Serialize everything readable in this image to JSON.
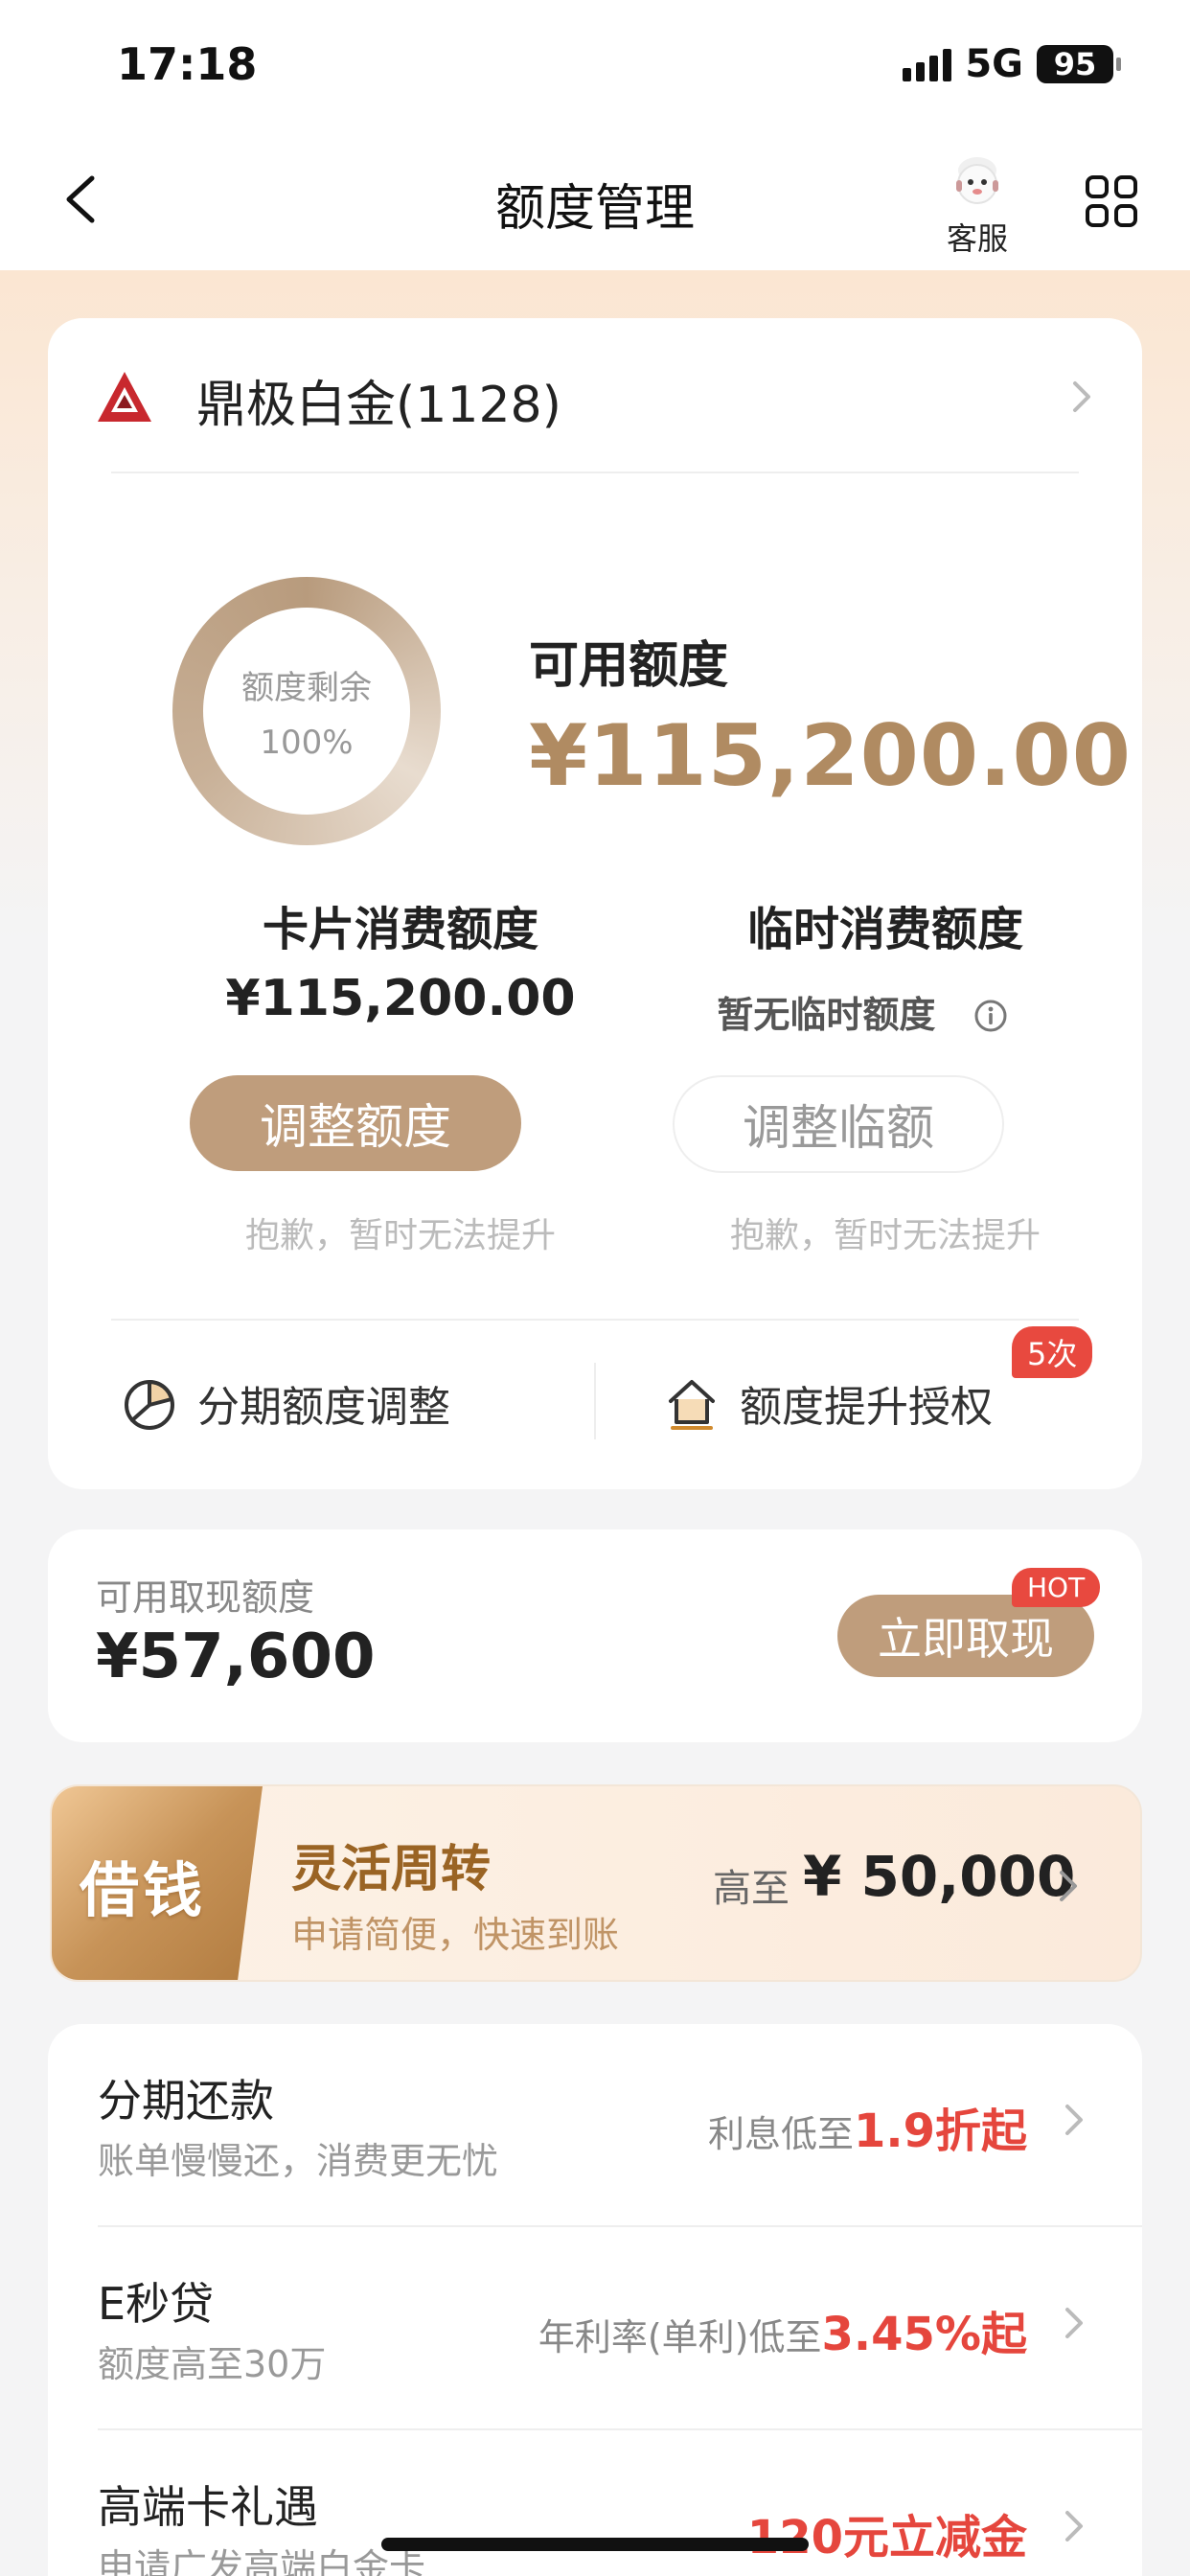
{
  "status_bar": {
    "time": "17:18",
    "network": "5G",
    "battery": "95"
  },
  "nav": {
    "title": "额度管理",
    "service_label": "客服"
  },
  "card": {
    "name": "鼎极白金(1128)",
    "ring_label": "额度剩余",
    "ring_percent": "100%",
    "ring_fill_percent": 100,
    "available_label": "可用额度",
    "available_value": "¥115,200.00"
  },
  "consumption": {
    "title": "卡片消费额度",
    "value": "¥115,200.00",
    "button": "调整额度",
    "note": "抱歉，暂时无法提升"
  },
  "temporary": {
    "title": "临时消费额度",
    "value": "暂无临时额度",
    "button": "调整临额",
    "note": "抱歉，暂时无法提升"
  },
  "links": {
    "installment_adjust": "分期额度调整",
    "limit_authorization": "额度提升授权",
    "authorization_badge": "5次"
  },
  "cash": {
    "label": "可用取现额度",
    "value": "¥57,600",
    "button": "立即取现",
    "badge": "HOT"
  },
  "loan": {
    "tag": "借钱",
    "title": "灵活周转",
    "subtitle": "申请简便，快速到账",
    "prefix": "高至",
    "amount": "¥ 50,000"
  },
  "services": [
    {
      "title": "分期还款",
      "subtitle": "账单慢慢还，消费更无忧",
      "hint": "利息低至",
      "highlight": "1.9折起"
    },
    {
      "title": "E秒贷",
      "subtitle": "额度高至30万",
      "hint": "年利率(单利)低至",
      "highlight": "3.45%起"
    },
    {
      "title": "高端卡礼遇",
      "subtitle": "申请广发高端白金卡",
      "hint": "",
      "highlight": "120元立减金"
    }
  ],
  "colors": {
    "accent": "#bf9d7c",
    "amount_gold": "#b08b62",
    "highlight_red": "#e5463d"
  }
}
